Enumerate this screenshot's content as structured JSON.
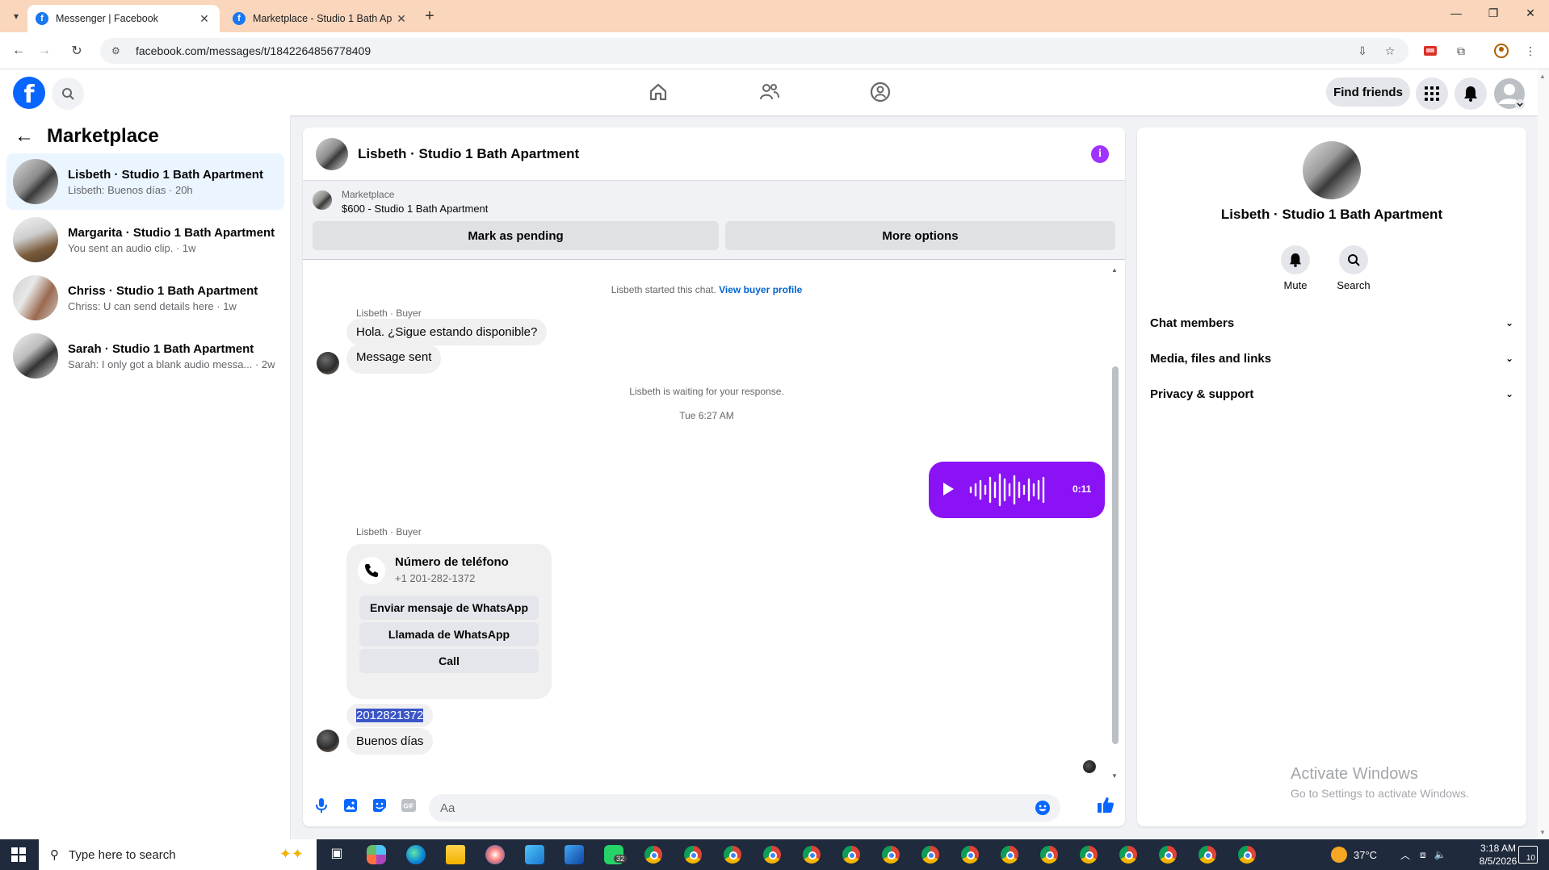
{
  "browser": {
    "tabs": [
      {
        "title": "Messenger | Facebook",
        "active": true
      },
      {
        "title": "Marketplace - Studio 1 Bath Ap",
        "active": false
      }
    ],
    "url": "facebook.com/messages/t/1842264856778409"
  },
  "header": {
    "find_friends": "Find friends"
  },
  "sidebar": {
    "title": "Marketplace",
    "conversations": [
      {
        "name": "Lisbeth · Studio 1 Bath Apartment",
        "preview": "Lisbeth: Buenos días · 20h",
        "active": true
      },
      {
        "name": "Margarita · Studio 1 Bath Apartment",
        "preview": "You sent an audio clip. · 1w",
        "active": false
      },
      {
        "name": "Chriss · Studio 1 Bath Apartment",
        "preview": "Chriss: U can send details here · 1w",
        "active": false
      },
      {
        "name": "Sarah · Studio 1 Bath Apartment",
        "preview": "Sarah: I only got a blank audio messa... · 2w",
        "active": false
      }
    ]
  },
  "chat": {
    "title": "Lisbeth · Studio 1 Bath Apartment",
    "listing_label": "Marketplace",
    "listing_title": "$600 - Studio 1 Bath Apartment",
    "mark_pending": "Mark as pending",
    "more_options": "More options",
    "started": "Lisbeth started this chat.",
    "view_buyer": "View buyer profile",
    "sender_label": "Lisbeth · Buyer",
    "msg1": "Hola. ¿Sigue estando disponible?",
    "msg2": "Message sent",
    "waiting": "Lisbeth is waiting for your response.",
    "timestamp": "Tue 6:27 AM",
    "audio_duration": "0:11",
    "card_title": "Número de teléfono",
    "card_number": "+1 201-282-1372",
    "card_btn1": "Enviar mensaje de WhatsApp",
    "card_btn2": "Llamada de WhatsApp",
    "card_btn3": "Call",
    "phone_msg": "2012821372",
    "last_msg": "Buenos días",
    "composer_placeholder": "Aa"
  },
  "details": {
    "name": "Lisbeth · Studio 1 Bath Apartment",
    "mute": "Mute",
    "search": "Search",
    "sections": [
      "Chat members",
      "Media, files and links",
      "Privacy & support"
    ],
    "activate_title": "Activate Windows",
    "activate_sub": "Go to Settings to activate Windows."
  },
  "taskbar": {
    "search_placeholder": "Type here to search",
    "whatsapp_badge": "32",
    "temperature": "37°C",
    "time": "3:18 AM",
    "date": "8/5/2026",
    "notifications": "10"
  },
  "colors": {
    "fb_blue": "#0866ff",
    "accent_purple": "#8a12f5",
    "active_row": "#ebf5ff",
    "taskbar": "#1f2a3c"
  }
}
